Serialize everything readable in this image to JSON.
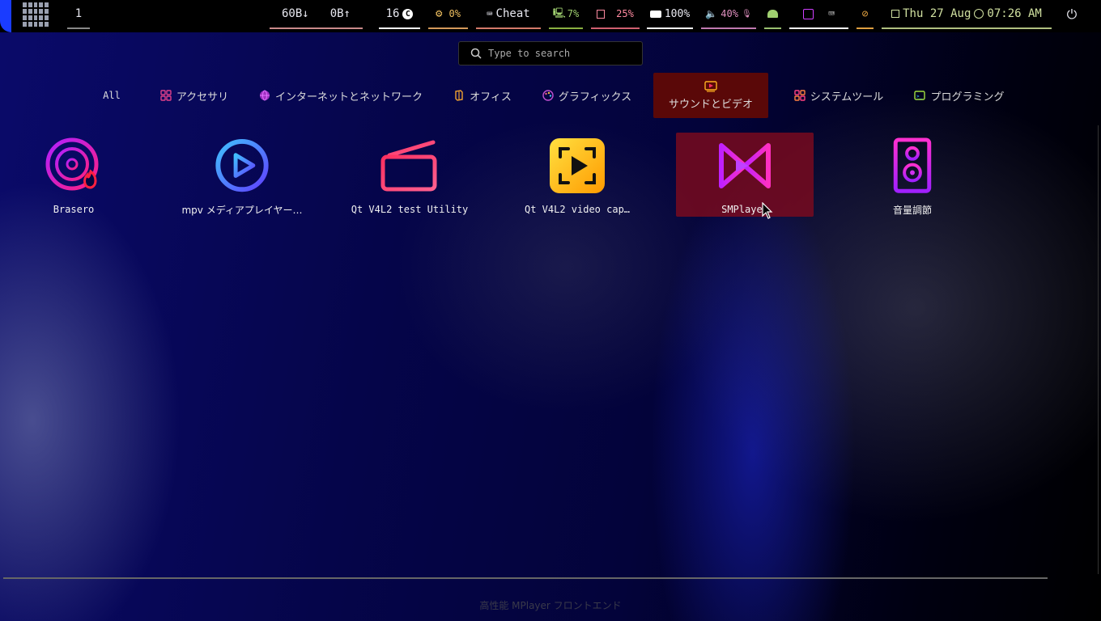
{
  "topbar": {
    "workspace": "1",
    "net_down": "60B↓",
    "net_up": "0B↑",
    "updates": "16",
    "cpu": "0%",
    "cheat": "Cheat",
    "temp": "7%",
    "memory": "25%",
    "battery": "100%",
    "volume": "40%",
    "date": "Thu 27 Aug",
    "time": "07:26 AM"
  },
  "search": {
    "placeholder": "Type to search"
  },
  "categories": [
    {
      "label": "All"
    },
    {
      "label": "アクセサリ"
    },
    {
      "label": "インターネットとネットワーク"
    },
    {
      "label": "オフィス"
    },
    {
      "label": "グラフィックス"
    },
    {
      "label": "サウンドとビデオ",
      "active": true
    },
    {
      "label": "システムツール"
    },
    {
      "label": "プログラミング"
    }
  ],
  "apps": [
    {
      "label": "Brasero"
    },
    {
      "label": "mpv メディアプレイヤー…"
    },
    {
      "label": "Qt V4L2 test Utility"
    },
    {
      "label": "Qt V4L2 video cap…"
    },
    {
      "label": "SMPlayer",
      "selected": true
    },
    {
      "label": "音量調節"
    }
  ],
  "description": "高性能 MPlayer フロントエンド",
  "colors": {
    "accent_active": "#5a0808",
    "selected_app": "#78101e",
    "desktop_blue": "#0a0a6a"
  }
}
